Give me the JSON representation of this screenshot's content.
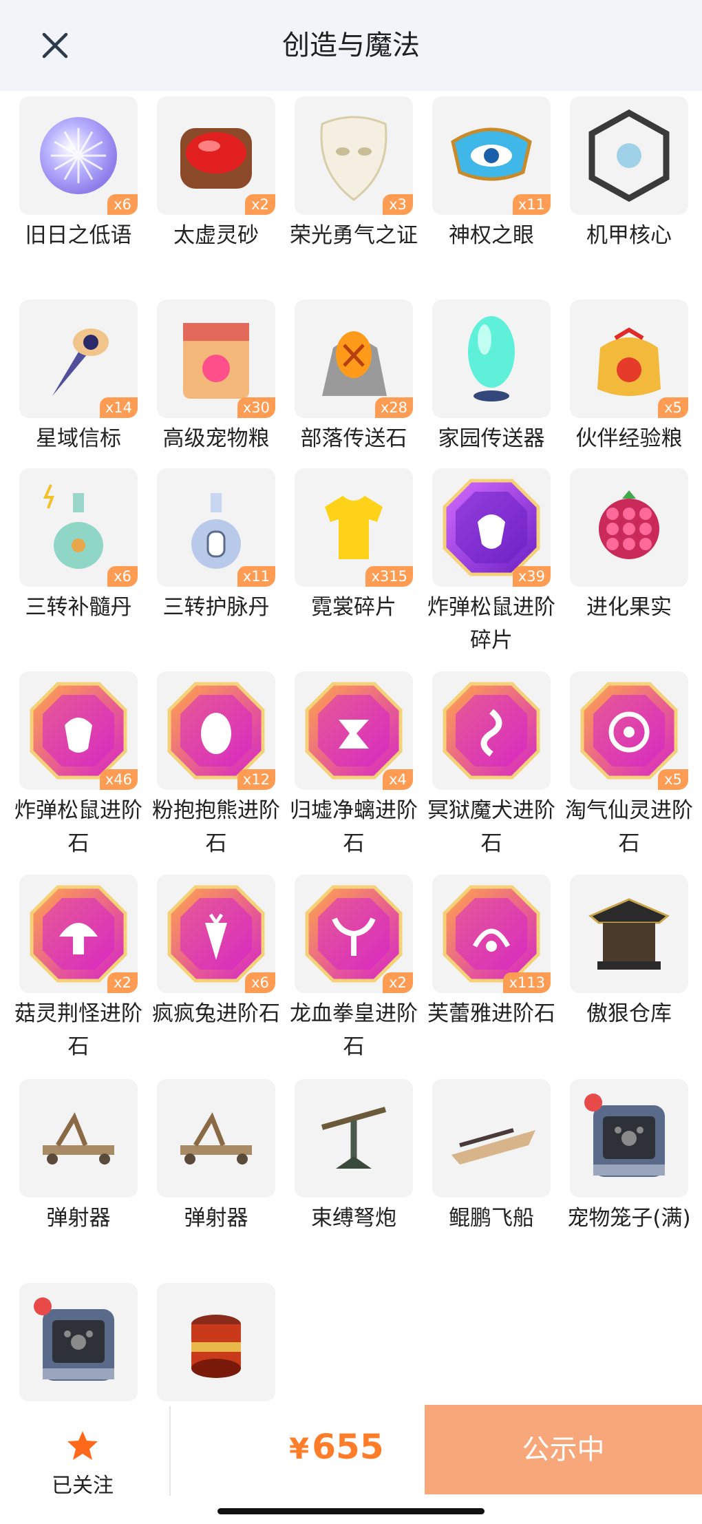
{
  "header": {
    "title": "创造与魔法"
  },
  "items": [
    {
      "name": "旧日之低语",
      "count": "x6",
      "icon": "purple-sphere-icon"
    },
    {
      "name": "太虚灵砂",
      "count": "x2",
      "icon": "red-gem-box-icon"
    },
    {
      "name": "荣光勇气之证",
      "count": "x3",
      "icon": "white-mask-icon"
    },
    {
      "name": "神权之眼",
      "count": "x11",
      "icon": "blue-eye-crown-icon"
    },
    {
      "name": "机甲核心",
      "count": "",
      "icon": "mech-core-cube-icon"
    },
    {
      "name": "星域信标",
      "count": "x14",
      "icon": "star-beacon-icon"
    },
    {
      "name": "高级宠物粮",
      "count": "x30",
      "icon": "pet-food-bag-icon"
    },
    {
      "name": "部落传送石",
      "count": "x28",
      "icon": "tribal-stone-icon"
    },
    {
      "name": "家园传送器",
      "count": "",
      "icon": "teal-crystal-icon"
    },
    {
      "name": "伙伴经验粮",
      "count": "x5",
      "icon": "gold-food-bag-icon"
    },
    {
      "name": "三转补髓丹",
      "count": "x6",
      "icon": "green-potion-icon"
    },
    {
      "name": "三转护脉丹",
      "count": "x11",
      "icon": "blue-potion-icon"
    },
    {
      "name": "霓裳碎片",
      "count": "x315",
      "icon": "yellow-shirt-icon"
    },
    {
      "name": "炸弹松鼠进阶碎片",
      "count": "x39",
      "icon": "purple-acorn-gem-icon"
    },
    {
      "name": "进化果实",
      "count": "",
      "icon": "evolution-fruit-icon"
    },
    {
      "name": "炸弹松鼠进阶石",
      "count": "x46",
      "icon": "acorn-evolve-gem-icon"
    },
    {
      "name": "粉抱抱熊进阶石",
      "count": "x12",
      "icon": "egg-evolve-gem-icon"
    },
    {
      "name": "归墟净螭进阶石",
      "count": "x4",
      "icon": "dragon-evolve-gem-icon"
    },
    {
      "name": "冥狱魔犬进阶石",
      "count": "",
      "icon": "flame-evolve-gem-icon"
    },
    {
      "name": "淘气仙灵进阶石",
      "count": "x5",
      "icon": "fairy-evolve-gem-icon"
    },
    {
      "name": "菇灵荆怪进阶石",
      "count": "x2",
      "icon": "mushroom-evolve-gem-icon"
    },
    {
      "name": "疯疯兔进阶石",
      "count": "x6",
      "icon": "carrot-evolve-gem-icon"
    },
    {
      "name": "龙血拳皇进阶石",
      "count": "x2",
      "icon": "bull-evolve-gem-icon"
    },
    {
      "name": "芙蕾雅进阶石",
      "count": "x113",
      "icon": "freya-evolve-gem-icon"
    },
    {
      "name": "傲狠仓库",
      "count": "",
      "icon": "pavilion-storage-icon"
    },
    {
      "name": "弹射器",
      "count": "",
      "icon": "catapult-icon"
    },
    {
      "name": "弹射器",
      "count": "",
      "icon": "catapult-icon"
    },
    {
      "name": "束缚弩炮",
      "count": "",
      "icon": "ballista-icon"
    },
    {
      "name": "鲲鹏飞船",
      "count": "",
      "icon": "airship-icon"
    },
    {
      "name": "宠物笼子(满)",
      "count": "",
      "icon": "pet-cage-icon"
    },
    {
      "name": "",
      "count": "",
      "icon": "pet-cage-icon"
    },
    {
      "name": "",
      "count": "",
      "icon": "red-drum-icon"
    }
  ],
  "bottom": {
    "follow_label": "已关注",
    "price_symbol": "¥",
    "price": "655",
    "status_label": "公示中"
  },
  "colors": {
    "accent": "#ff7c28",
    "button": "#f8a77a",
    "badge": "#ff9c54"
  }
}
